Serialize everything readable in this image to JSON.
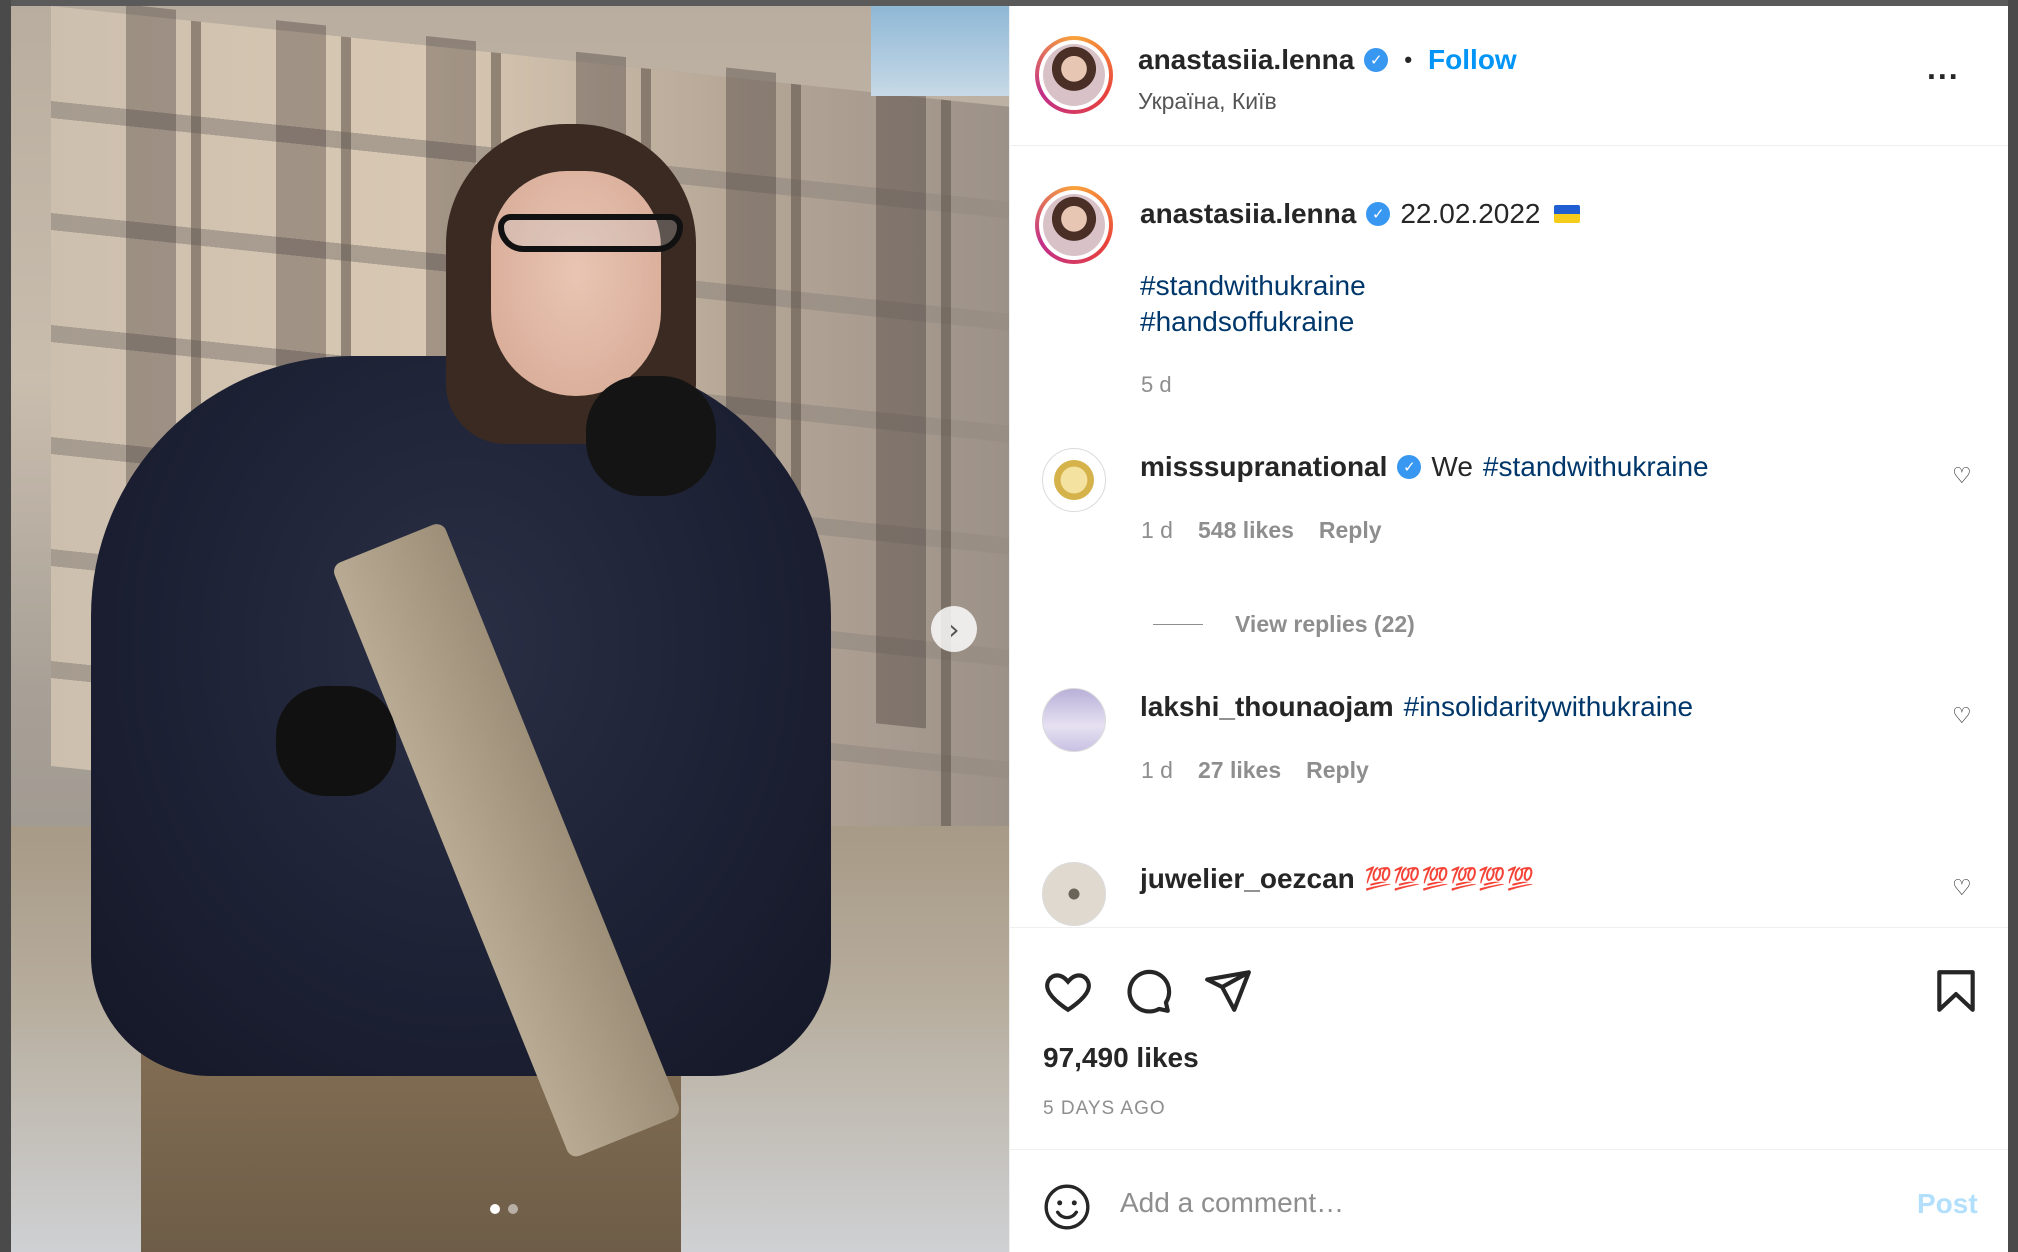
{
  "header": {
    "username": "anastasiia.lenna",
    "verified_mark": "✓",
    "separator": "•",
    "follow_label": "Follow",
    "location": "Україна, Київ",
    "more_label": "..."
  },
  "caption": {
    "username": "anastasiia.lenna",
    "date_text": "22.02.2022",
    "hashtags": [
      "#standwithukraine",
      "#handsoffukraine"
    ],
    "time": "5 d"
  },
  "comments": [
    {
      "username": "misssupranational",
      "verified": true,
      "text_prefix": "We",
      "hashtag": "#standwithukraine",
      "time": "1 d",
      "likes": "548 likes",
      "reply_label": "Reply"
    },
    {
      "username": "lakshi_thounaojam",
      "hashtag": "#insolidaritywithukraine",
      "time": "1 d",
      "likes": "27 likes",
      "reply_label": "Reply"
    },
    {
      "username": "juwelier_oezcan",
      "emoji_text": "💯💯💯💯💯💯"
    }
  ],
  "view_replies_label": "View replies (22)",
  "likes_count": "97,490 likes",
  "time_ago": "5 DAYS AGO",
  "add_comment": {
    "placeholder": "Add a comment…",
    "post_label": "Post"
  },
  "carousel": {
    "current_slide": 1,
    "total_slides": 2,
    "next_label": "›"
  },
  "colors": {
    "accent": "#0095f6",
    "hashtag": "#00376b",
    "secondary_text": "#8e8e8e",
    "verified": "#3897f0"
  }
}
